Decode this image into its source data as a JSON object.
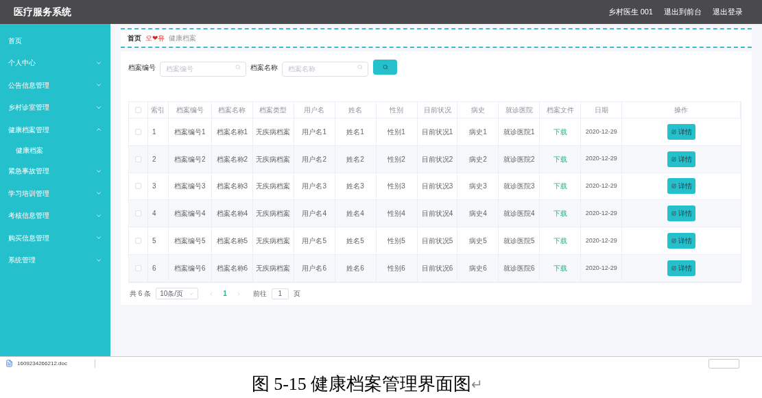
{
  "header": {
    "title": "医疗服务系统",
    "user": "乡村医生 001",
    "links": [
      "退出到前台",
      "退出登录"
    ]
  },
  "sidebar": {
    "items": [
      {
        "label": "首页",
        "kind": "link"
      },
      {
        "label": "个人中心",
        "kind": "group",
        "expanded": false
      },
      {
        "label": "公告信息管理",
        "kind": "group",
        "expanded": false
      },
      {
        "label": "乡村诊室管理",
        "kind": "group",
        "expanded": false
      },
      {
        "label": "健康档案管理",
        "kind": "group",
        "expanded": true,
        "children": [
          {
            "label": "健康档案"
          }
        ]
      },
      {
        "label": "紧急事故管理",
        "kind": "group",
        "expanded": false
      },
      {
        "label": "学习培训管理",
        "kind": "group",
        "expanded": false
      },
      {
        "label": "考核信息管理",
        "kind": "group",
        "expanded": false
      },
      {
        "label": "购买信息管理",
        "kind": "group",
        "expanded": false
      },
      {
        "label": "系统管理",
        "kind": "group",
        "expanded": false
      }
    ]
  },
  "breadcrumb": {
    "home": "首页",
    "ornament": "오❤유",
    "current": "健康档案"
  },
  "search": {
    "fields": [
      {
        "label": "档案编号",
        "placeholder": "档案编号"
      },
      {
        "label": "档案名称",
        "placeholder": "档案名称"
      }
    ]
  },
  "table": {
    "all_checked": false,
    "columns": [
      "索引",
      "档案编号",
      "档案名称",
      "档案类型",
      "用户名",
      "姓名",
      "性别",
      "目前状况",
      "病史",
      "就诊医院",
      "档案文件",
      "日期",
      "操作"
    ],
    "rows": [
      {
        "checked": false,
        "cells": [
          "1",
          "档案编号1",
          "档案名称1",
          "无疾病档案",
          "用户名1",
          "姓名1",
          "性别1",
          "目前状况1",
          "病史1",
          "就诊医院1"
        ],
        "file": "下载",
        "date": "2020-12-29",
        "action": "详情"
      },
      {
        "checked": false,
        "cells": [
          "2",
          "档案编号2",
          "档案名称2",
          "无疾病档案",
          "用户名2",
          "姓名2",
          "性别2",
          "目前状况2",
          "病史2",
          "就诊医院2"
        ],
        "file": "下载",
        "date": "2020-12-29",
        "action": "详情"
      },
      {
        "checked": false,
        "cells": [
          "3",
          "档案编号3",
          "档案名称3",
          "无疾病档案",
          "用户名3",
          "姓名3",
          "性别3",
          "目前状况3",
          "病史3",
          "就诊医院3"
        ],
        "file": "下载",
        "date": "2020-12-29",
        "action": "详情"
      },
      {
        "checked": false,
        "cells": [
          "4",
          "档案编号4",
          "档案名称4",
          "无疾病档案",
          "用户名4",
          "姓名4",
          "性别4",
          "目前状况4",
          "病史4",
          "就诊医院4"
        ],
        "file": "下载",
        "date": "2020-12-29",
        "action": "详情"
      },
      {
        "checked": false,
        "cells": [
          "5",
          "档案编号5",
          "档案名称5",
          "无疾病档案",
          "用户名5",
          "姓名5",
          "性别5",
          "目前状况5",
          "病史5",
          "就诊医院5"
        ],
        "file": "下载",
        "date": "2020-12-29",
        "action": "详情"
      },
      {
        "checked": false,
        "cells": [
          "6",
          "档案编号6",
          "档案名称6",
          "无疾病档案",
          "用户名6",
          "姓名6",
          "性别6",
          "目前状况6",
          "病史6",
          "就诊医院6"
        ],
        "file": "下载",
        "date": "2020-12-29",
        "action": "详情"
      }
    ]
  },
  "pagination": {
    "total": "共 6 条",
    "page_size": "10条/页",
    "pages": [
      {
        "label": "1",
        "selected": true
      }
    ],
    "goto": "前往",
    "goto_value": "1",
    "page_unit": "页"
  },
  "download_bar": {
    "file": "1609234266212.doc"
  },
  "caption": {
    "text": "图 5-15 健康档案管理界面图",
    "mark": "↵"
  }
}
